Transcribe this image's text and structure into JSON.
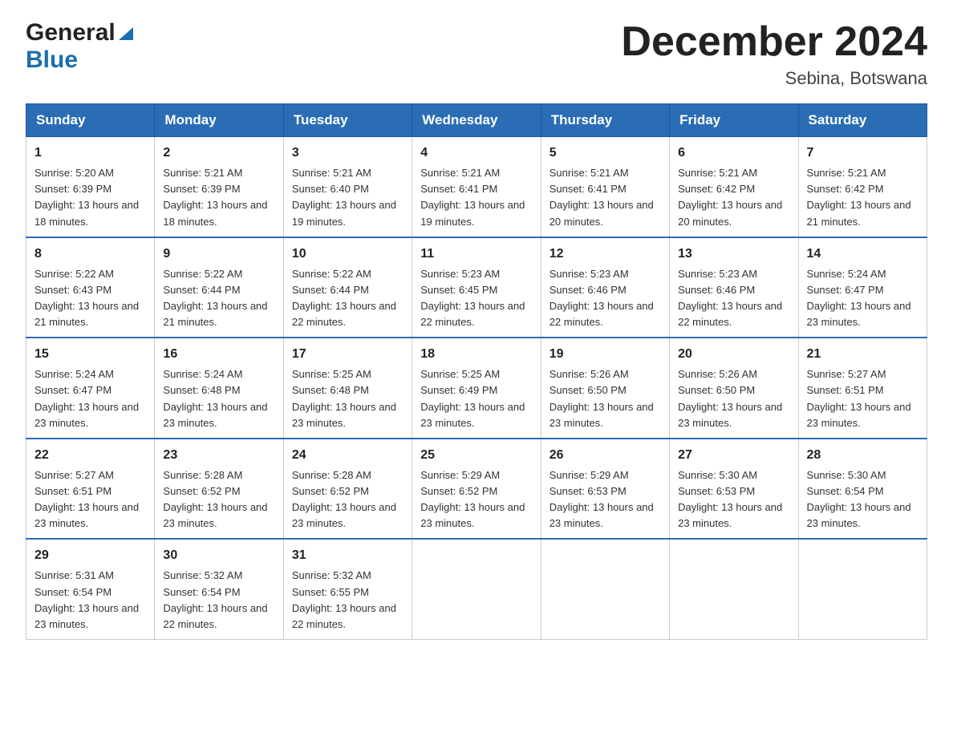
{
  "logo": {
    "general": "General",
    "blue": "Blue"
  },
  "title": "December 2024",
  "location": "Sebina, Botswana",
  "days_of_week": [
    "Sunday",
    "Monday",
    "Tuesday",
    "Wednesday",
    "Thursday",
    "Friday",
    "Saturday"
  ],
  "weeks": [
    [
      {
        "day": 1,
        "sunrise": "5:20 AM",
        "sunset": "6:39 PM",
        "daylight": "13 hours and 18 minutes."
      },
      {
        "day": 2,
        "sunrise": "5:21 AM",
        "sunset": "6:39 PM",
        "daylight": "13 hours and 18 minutes."
      },
      {
        "day": 3,
        "sunrise": "5:21 AM",
        "sunset": "6:40 PM",
        "daylight": "13 hours and 19 minutes."
      },
      {
        "day": 4,
        "sunrise": "5:21 AM",
        "sunset": "6:41 PM",
        "daylight": "13 hours and 19 minutes."
      },
      {
        "day": 5,
        "sunrise": "5:21 AM",
        "sunset": "6:41 PM",
        "daylight": "13 hours and 20 minutes."
      },
      {
        "day": 6,
        "sunrise": "5:21 AM",
        "sunset": "6:42 PM",
        "daylight": "13 hours and 20 minutes."
      },
      {
        "day": 7,
        "sunrise": "5:21 AM",
        "sunset": "6:42 PM",
        "daylight": "13 hours and 21 minutes."
      }
    ],
    [
      {
        "day": 8,
        "sunrise": "5:22 AM",
        "sunset": "6:43 PM",
        "daylight": "13 hours and 21 minutes."
      },
      {
        "day": 9,
        "sunrise": "5:22 AM",
        "sunset": "6:44 PM",
        "daylight": "13 hours and 21 minutes."
      },
      {
        "day": 10,
        "sunrise": "5:22 AM",
        "sunset": "6:44 PM",
        "daylight": "13 hours and 22 minutes."
      },
      {
        "day": 11,
        "sunrise": "5:23 AM",
        "sunset": "6:45 PM",
        "daylight": "13 hours and 22 minutes."
      },
      {
        "day": 12,
        "sunrise": "5:23 AM",
        "sunset": "6:46 PM",
        "daylight": "13 hours and 22 minutes."
      },
      {
        "day": 13,
        "sunrise": "5:23 AM",
        "sunset": "6:46 PM",
        "daylight": "13 hours and 22 minutes."
      },
      {
        "day": 14,
        "sunrise": "5:24 AM",
        "sunset": "6:47 PM",
        "daylight": "13 hours and 23 minutes."
      }
    ],
    [
      {
        "day": 15,
        "sunrise": "5:24 AM",
        "sunset": "6:47 PM",
        "daylight": "13 hours and 23 minutes."
      },
      {
        "day": 16,
        "sunrise": "5:24 AM",
        "sunset": "6:48 PM",
        "daylight": "13 hours and 23 minutes."
      },
      {
        "day": 17,
        "sunrise": "5:25 AM",
        "sunset": "6:48 PM",
        "daylight": "13 hours and 23 minutes."
      },
      {
        "day": 18,
        "sunrise": "5:25 AM",
        "sunset": "6:49 PM",
        "daylight": "13 hours and 23 minutes."
      },
      {
        "day": 19,
        "sunrise": "5:26 AM",
        "sunset": "6:50 PM",
        "daylight": "13 hours and 23 minutes."
      },
      {
        "day": 20,
        "sunrise": "5:26 AM",
        "sunset": "6:50 PM",
        "daylight": "13 hours and 23 minutes."
      },
      {
        "day": 21,
        "sunrise": "5:27 AM",
        "sunset": "6:51 PM",
        "daylight": "13 hours and 23 minutes."
      }
    ],
    [
      {
        "day": 22,
        "sunrise": "5:27 AM",
        "sunset": "6:51 PM",
        "daylight": "13 hours and 23 minutes."
      },
      {
        "day": 23,
        "sunrise": "5:28 AM",
        "sunset": "6:52 PM",
        "daylight": "13 hours and 23 minutes."
      },
      {
        "day": 24,
        "sunrise": "5:28 AM",
        "sunset": "6:52 PM",
        "daylight": "13 hours and 23 minutes."
      },
      {
        "day": 25,
        "sunrise": "5:29 AM",
        "sunset": "6:52 PM",
        "daylight": "13 hours and 23 minutes."
      },
      {
        "day": 26,
        "sunrise": "5:29 AM",
        "sunset": "6:53 PM",
        "daylight": "13 hours and 23 minutes."
      },
      {
        "day": 27,
        "sunrise": "5:30 AM",
        "sunset": "6:53 PM",
        "daylight": "13 hours and 23 minutes."
      },
      {
        "day": 28,
        "sunrise": "5:30 AM",
        "sunset": "6:54 PM",
        "daylight": "13 hours and 23 minutes."
      }
    ],
    [
      {
        "day": 29,
        "sunrise": "5:31 AM",
        "sunset": "6:54 PM",
        "daylight": "13 hours and 23 minutes."
      },
      {
        "day": 30,
        "sunrise": "5:32 AM",
        "sunset": "6:54 PM",
        "daylight": "13 hours and 22 minutes."
      },
      {
        "day": 31,
        "sunrise": "5:32 AM",
        "sunset": "6:55 PM",
        "daylight": "13 hours and 22 minutes."
      },
      null,
      null,
      null,
      null
    ]
  ]
}
